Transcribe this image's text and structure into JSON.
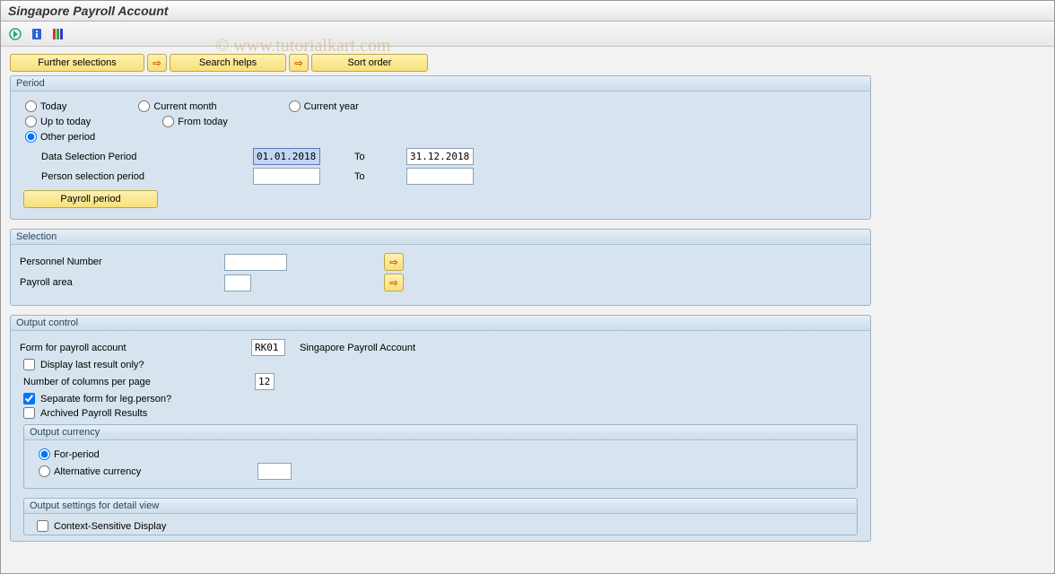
{
  "title": "Singapore Payroll Account",
  "watermark": "© www.tutorialkart.com",
  "buttons": {
    "further_selections": "Further selections",
    "search_helps": "Search helps",
    "sort_order": "Sort order",
    "payroll_period": "Payroll period"
  },
  "period": {
    "title": "Period",
    "today": "Today",
    "current_month": "Current month",
    "current_year": "Current year",
    "up_to_today": "Up to today",
    "from_today": "From today",
    "other_period": "Other period",
    "data_selection_label": "Data Selection Period",
    "data_selection_from": "01.01.2018",
    "data_selection_to": "31.12.2018",
    "person_selection_label": "Person selection period",
    "person_selection_from": "",
    "person_selection_to": "",
    "to_label": "To"
  },
  "selection": {
    "title": "Selection",
    "personnel_number_label": "Personnel Number",
    "personnel_number_value": "",
    "payroll_area_label": "Payroll area",
    "payroll_area_value": ""
  },
  "output_control": {
    "title": "Output control",
    "form_label": "Form for payroll account",
    "form_code": "RK01",
    "form_desc": "Singapore Payroll Account",
    "display_last_result": "Display last result only?",
    "columns_label": "Number of columns per page",
    "columns_value": "12",
    "separate_form": "Separate form for leg.person?",
    "archived_results": "Archived Payroll Results",
    "output_currency": {
      "title": "Output currency",
      "for_period": "For-period",
      "alternative": "Alternative currency",
      "alternative_value": ""
    },
    "output_settings": {
      "title": "Output settings for detail view",
      "context_sensitive": "Context-Sensitive Display"
    }
  }
}
